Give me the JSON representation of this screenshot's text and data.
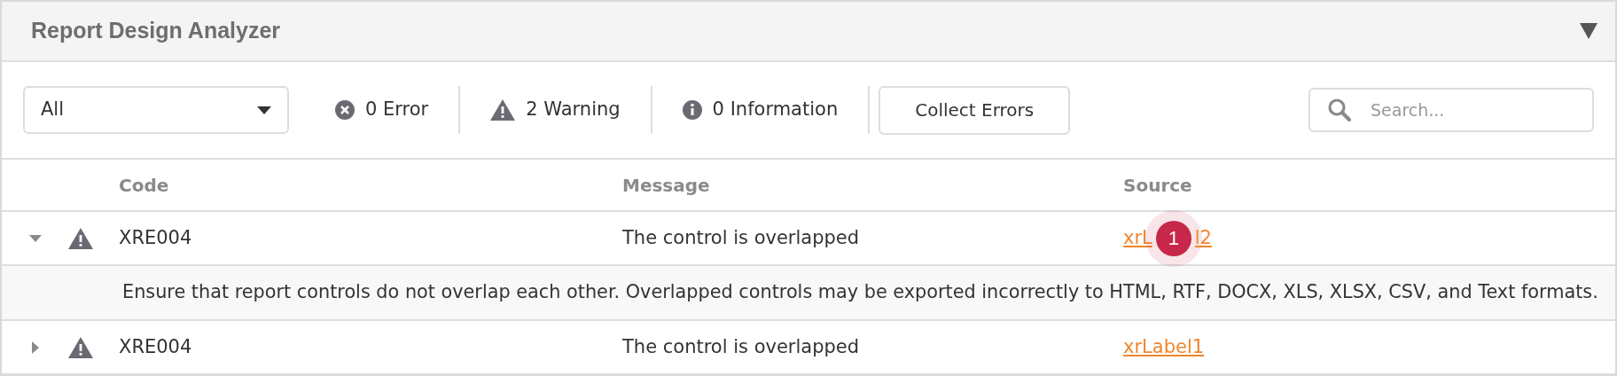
{
  "panel": {
    "title": "Report Design Analyzer",
    "collapsed": false
  },
  "toolbar": {
    "filter": {
      "value": "All"
    },
    "counters": [
      {
        "kind": "error",
        "label": "0 Error"
      },
      {
        "kind": "warning",
        "label": "2 Warning"
      },
      {
        "kind": "information",
        "label": "0 Information"
      }
    ],
    "button": "Collect Errors",
    "search": {
      "placeholder": "Search..."
    }
  },
  "table": {
    "columns": [
      "Code",
      "Message",
      "Source"
    ],
    "rows": [
      {
        "kind": "warning",
        "expanded": true,
        "code": "XRE004",
        "message": "The control is overlapped",
        "source": [
          "xrL",
          "l2"
        ],
        "details": "Ensure that report controls do not overlap each other. Overlapped controls may be exported incorrectly to HTML, RTF, DOCX, XLS, XLSX, CSV, and Text formats."
      },
      {
        "kind": "warning",
        "expanded": false,
        "code": "XRE004",
        "message": "The control is overlapped",
        "source": [
          "xrLabel1"
        ]
      }
    ]
  },
  "callout": {
    "label": "1"
  }
}
